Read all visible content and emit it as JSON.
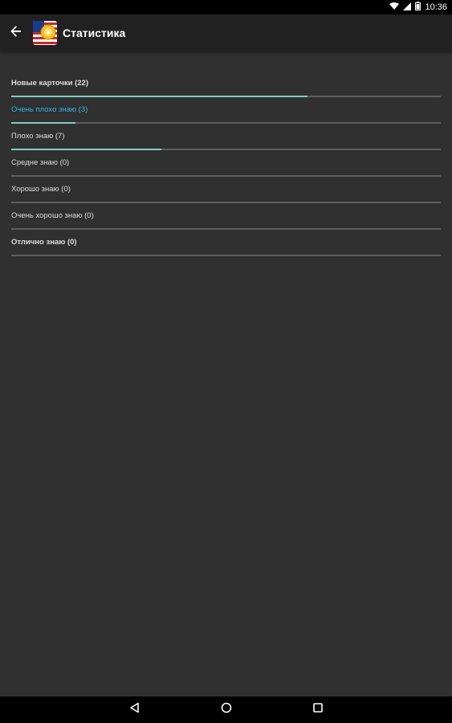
{
  "status_bar": {
    "time": "10:36",
    "icons": [
      "wifi-icon",
      "signal-icon",
      "battery-icon"
    ]
  },
  "app_bar": {
    "title": "Статистика",
    "back_icon": "arrow-back-icon",
    "logo_icon": "us-flag-app-logo"
  },
  "stats": {
    "items": [
      {
        "label": "Новые карточки (22)",
        "progress": 0.69
      },
      {
        "label": "Очень плохо знаю (3)",
        "progress": 0.15
      },
      {
        "label": "Плохо знаю (7)",
        "progress": 0.35
      },
      {
        "label": "Средне знаю (0)",
        "progress": 0
      },
      {
        "label": "Хорошо знаю (0)",
        "progress": 0
      },
      {
        "label": "Очень хорошо знаю (0)",
        "progress": 0
      },
      {
        "label": "Отлично знаю (0)",
        "progress": 0
      }
    ]
  },
  "colors": {
    "progress_fill": "#80cbc4",
    "accent_text": "#33b5e5",
    "track": "#5e5e5e",
    "background": "#303030",
    "app_bar": "#212121"
  },
  "nav_bar": {
    "buttons": [
      "back-triangle-icon",
      "home-circle-icon",
      "recents-square-icon"
    ]
  }
}
